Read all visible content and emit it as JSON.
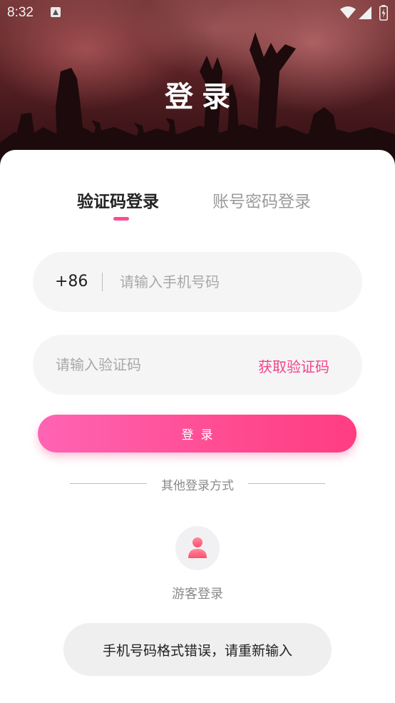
{
  "status_bar": {
    "time": "8:32"
  },
  "header": {
    "title": "登录"
  },
  "tabs": [
    {
      "label": "验证码登录",
      "active": true
    },
    {
      "label": "账号密码登录",
      "active": false
    }
  ],
  "phone": {
    "prefix": "+86",
    "placeholder": "请输入手机号码",
    "value": ""
  },
  "code": {
    "placeholder": "请输入验证码",
    "value": "",
    "get_code_label": "获取验证码"
  },
  "login_button": {
    "label": "登录"
  },
  "other_methods": {
    "label": "其他登录方式",
    "guest_label": "游客登录"
  },
  "toast": {
    "message": "手机号码格式错误，请重新输入"
  },
  "colors": {
    "accent": "#ff4b91",
    "accent_text": "#f1448a",
    "field_bg": "#f5f5f5"
  },
  "icons": [
    "notification-icon",
    "wifi-icon",
    "signal-icon",
    "battery-icon",
    "guest-user-icon"
  ]
}
